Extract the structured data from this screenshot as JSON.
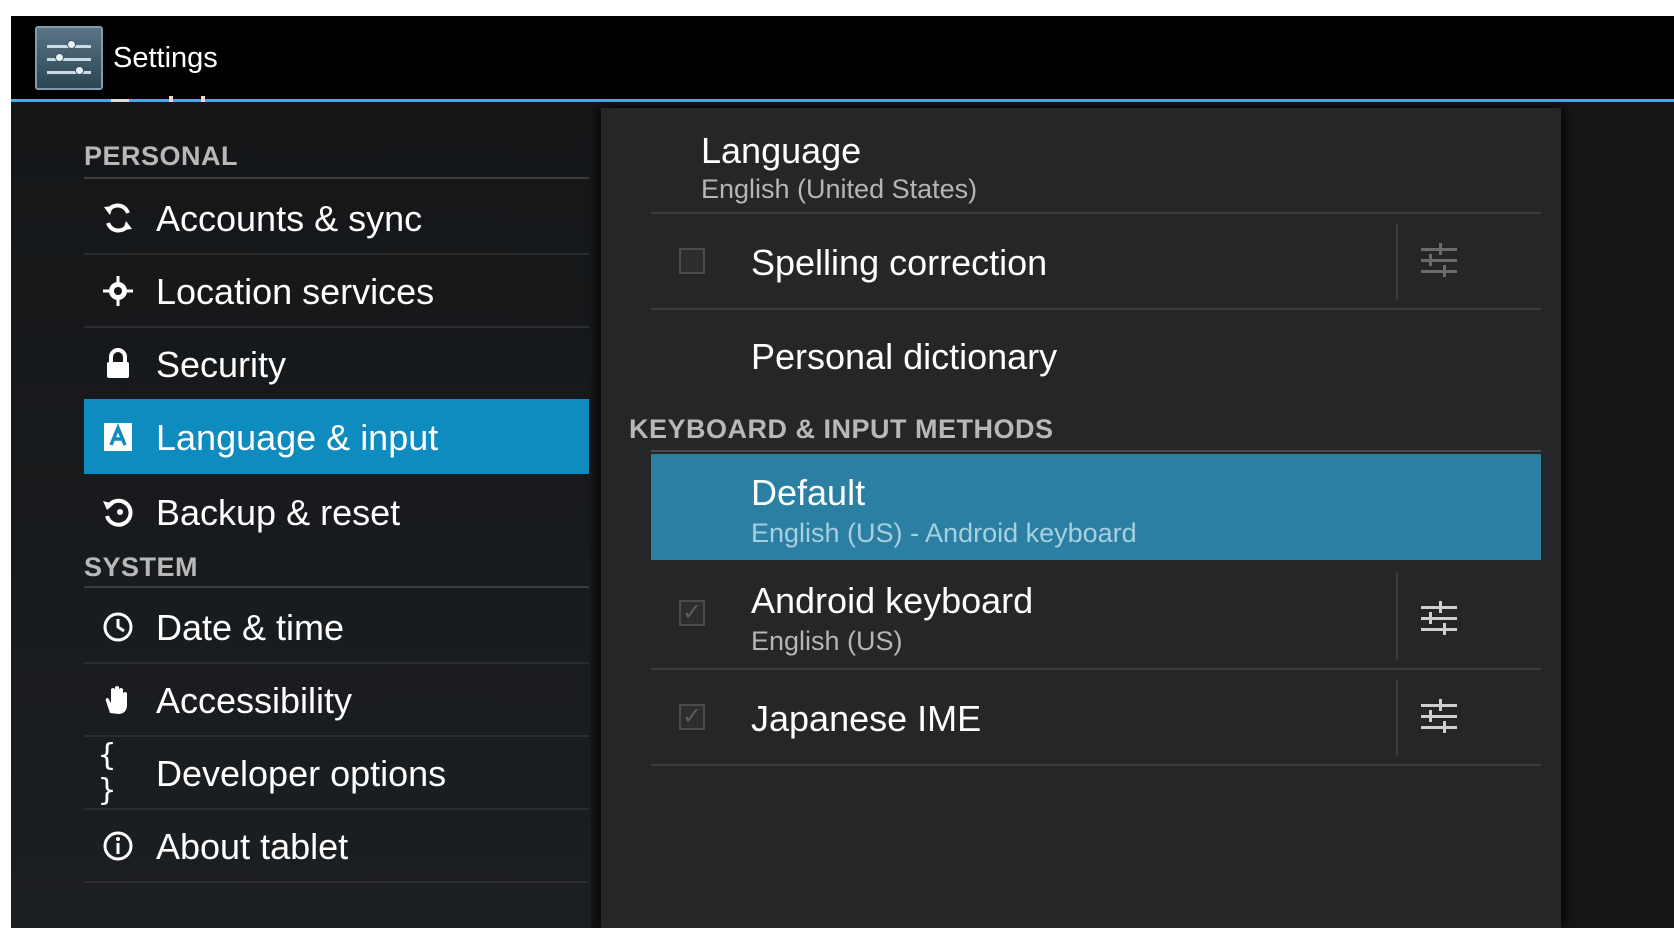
{
  "app": {
    "title": "Settings"
  },
  "sidebar": {
    "sections": [
      {
        "label": "PERSONAL"
      },
      {
        "label": "SYSTEM"
      }
    ],
    "items": [
      {
        "label": "Accounts & sync",
        "icon": "sync-icon"
      },
      {
        "label": "Location services",
        "icon": "location-icon"
      },
      {
        "label": "Security",
        "icon": "lock-icon"
      },
      {
        "label": "Language & input",
        "icon": "keyboard-letter-icon",
        "selected": true
      },
      {
        "label": "Backup & reset",
        "icon": "restore-icon"
      },
      {
        "label": "Date & time",
        "icon": "clock-icon"
      },
      {
        "label": "Accessibility",
        "icon": "hand-icon"
      },
      {
        "label": "Developer options",
        "icon": "braces-icon"
      },
      {
        "label": "About tablet",
        "icon": "info-icon"
      }
    ]
  },
  "content": {
    "language": {
      "title": "Language",
      "summary": "English (United States)"
    },
    "spelling": {
      "title": "Spelling correction",
      "checked": false
    },
    "dictionary": {
      "title": "Personal dictionary"
    },
    "keyboard_section": "KEYBOARD & INPUT METHODS",
    "default": {
      "title": "Default",
      "summary": "English (US) - Android keyboard"
    },
    "android_keyboard": {
      "title": "Android keyboard",
      "summary": "English (US)",
      "checked": true
    },
    "japanese_ime": {
      "title": "Japanese IME",
      "checked": true
    }
  },
  "colors": {
    "accent": "#33b5e5",
    "selected_item": "#0e8bbf",
    "highlight_row": "#2a7fa3"
  }
}
